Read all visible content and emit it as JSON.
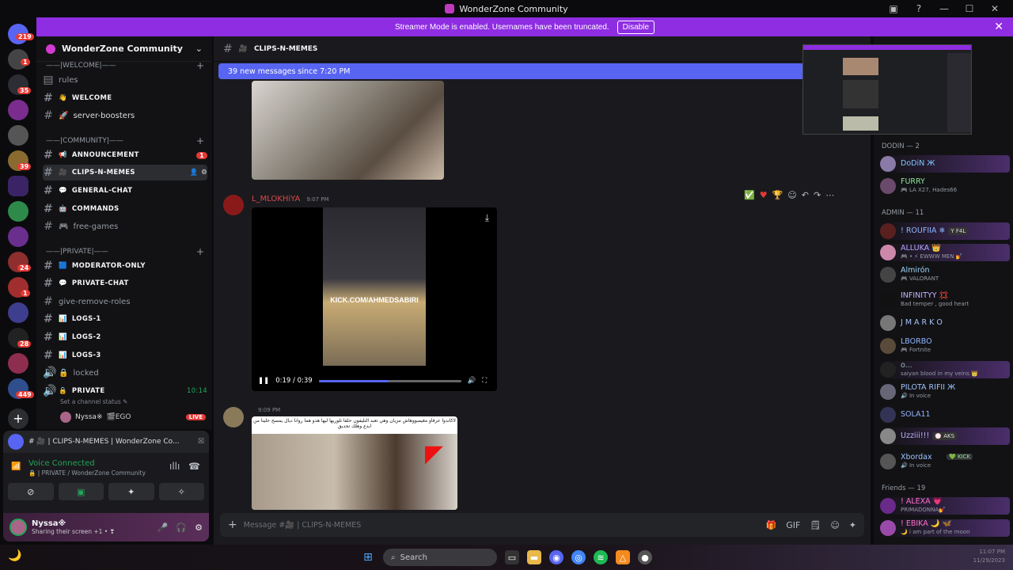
{
  "window": {
    "title": "WonderZone Community",
    "controls": [
      "▣",
      "?",
      "—",
      "☐",
      "✕"
    ]
  },
  "banner": {
    "text": "Streamer Mode is enabled. Usernames have been truncated.",
    "button": "Disable",
    "close": "✕",
    "color": "#8e2de2"
  },
  "server_rail": {
    "badges": [
      "219",
      "1",
      "35",
      "39",
      "24",
      "1",
      "28",
      "449"
    ],
    "add_server": "+"
  },
  "sidebar": {
    "server_name": "WonderZone Community",
    "categories": [
      {
        "label": "——|WELCOME|——",
        "plus": "+"
      },
      {
        "label": "——|COMMUNITY|——",
        "plus": "+"
      },
      {
        "label": "——|PRIVATE|——",
        "plus": "+"
      }
    ],
    "channels": [
      {
        "hash": "▤",
        "label": "rules",
        "emoji": ""
      },
      {
        "hash": "#",
        "label": "WELCOME",
        "emoji": "👋"
      },
      {
        "hash": "#",
        "label": "server-boosters",
        "emoji": "🚀"
      },
      {
        "hash": "#",
        "label": "ANNOUNCEMENT",
        "emoji": "📢",
        "badge": "1"
      },
      {
        "hash": "#",
        "label": "CLIPS-N-MEMES",
        "emoji": "🎥"
      },
      {
        "hash": "#",
        "label": "GENERAL-CHAT",
        "emoji": "💬"
      },
      {
        "hash": "#",
        "label": "COMMANDS",
        "emoji": "🤖"
      },
      {
        "hash": "#",
        "label": "free-games",
        "emoji": "🎮"
      },
      {
        "hash": "#",
        "label": "MODERATOR-ONLY",
        "emoji": "🟦"
      },
      {
        "hash": "#",
        "label": "PRIVATE-CHAT",
        "emoji": "💬"
      },
      {
        "hash": "#",
        "label": "give-remove-roles",
        "emoji": ""
      },
      {
        "hash": "#",
        "label": "LOGS-1",
        "emoji": "📊"
      },
      {
        "hash": "#",
        "label": "LOGS-2",
        "emoji": "📊"
      },
      {
        "hash": "#",
        "label": "LOGS-3",
        "emoji": "📊"
      },
      {
        "hash": "🔊",
        "label": "locked",
        "emoji": "🔒"
      },
      {
        "hash": "🔊",
        "label": "PRIVATE",
        "emoji": "🔒",
        "time": "10:14"
      }
    ],
    "channel_status": "Set a channel status ✎",
    "voice_user": {
      "name": "Nyssa※",
      "tag": "🎬EGO",
      "live": "LIVE"
    }
  },
  "voice_panel": {
    "stream_title": "# 🎥 | CLIPS-N-MEMES | WonderZone Co...",
    "connected": "Voice Connected",
    "location": "🔒 | PRIVATE / WonderZone Community",
    "buttons": [
      "⊘",
      "▣",
      "✦",
      "✧"
    ]
  },
  "user": {
    "name": "Nyssa※",
    "status": "Sharing their screen +1 • ❣",
    "controls": [
      "🎤",
      "🎧",
      "⚙"
    ]
  },
  "channel": {
    "name": "CLIPS-N-MEMES",
    "new_messages": "39 new messages since 7:20 PM",
    "mark": "M"
  },
  "messages": [
    {
      "author": "L_MLOKHiYA",
      "time": "9:07 PM",
      "color": "#d84a4a"
    },
    {
      "author": "",
      "time": "9:09 PM",
      "color": "#5865f2"
    }
  ],
  "video": {
    "overlay": "KICK.COM/AHMEDSABIRI",
    "time": "0:19 / 0:39",
    "progress": 0.49
  },
  "reactions": [
    "✅",
    "♥",
    "🏆",
    "☺",
    "↶",
    "↷",
    "⋯"
  ],
  "meme_caption": "لاكاندوا عرفاو مغيصووهاش مزيان وهي تعبد التليفون حلقا تلوريها ليها هذو هما روانا ديال يمسح حلينا من ابدع وهلك تحديق",
  "composer": {
    "placeholder": "Message #🎥 | CLIPS-N-MEMES",
    "tools": [
      "🎁",
      "GIF",
      "🗒",
      "☺",
      "✦"
    ]
  },
  "members": {
    "sections": [
      "DODIN — 2",
      "ADMIN — 11",
      "Friends — 19"
    ],
    "list": [
      {
        "name": "DoDiN Ж",
        "status": "",
        "color": "#7ec8ff"
      },
      {
        "name": "FURRY",
        "status": "🎮 LA X27, Hades66",
        "color": "#8fe39f"
      },
      {
        "name": "! ROUFIIA ❄",
        "status": "",
        "tag": "Y F4L",
        "color": "#8fb8ff"
      },
      {
        "name": "ALLUKA 👑",
        "status": "🎮 • ⚡ EWWW MEN 💅",
        "color": "#b6a4ff"
      },
      {
        "name": "Almirón",
        "status": "🎮 VALORANT",
        "color": "#9fd6ff"
      },
      {
        "name": "INFINITYY 💢",
        "status": "Bad temper , good heart",
        "color": "#c6b4ff"
      },
      {
        "name": "J M A R K O",
        "status": "",
        "color": "#a6c4ff"
      },
      {
        "name": "LBORBO",
        "status": "🎮 Fortnite",
        "color": "#8eb6ff"
      },
      {
        "name": "o...",
        "status": "saiyan blood in my veins 👑",
        "color": "#9bb"
      },
      {
        "name": "PILOTA RIFII Ж",
        "status": "🔊 In voice",
        "color": "#9ec2ff"
      },
      {
        "name": "SOLA11",
        "status": "",
        "color": "#8fb4ff"
      },
      {
        "name": "Uzziii!!!",
        "status": "",
        "tag": "💮 AKS",
        "color": "#b9b4ff"
      },
      {
        "name": "Xbordax",
        "status": "🔊 In voice",
        "tag": "💚 KICK",
        "color": "#9ec2ff"
      },
      {
        "name": "! ALEXA 💗",
        "status": "PRIMADONNA💅",
        "color": "#ff6fc8"
      },
      {
        "name": "! EBIKA 🌙 🦋",
        "status": "🌙 i am part of the moon",
        "color": "#ff6fc8"
      }
    ]
  },
  "taskbar": {
    "search": "Search",
    "clock_time": "11:07 PM",
    "clock_date": "11/29/2023"
  }
}
